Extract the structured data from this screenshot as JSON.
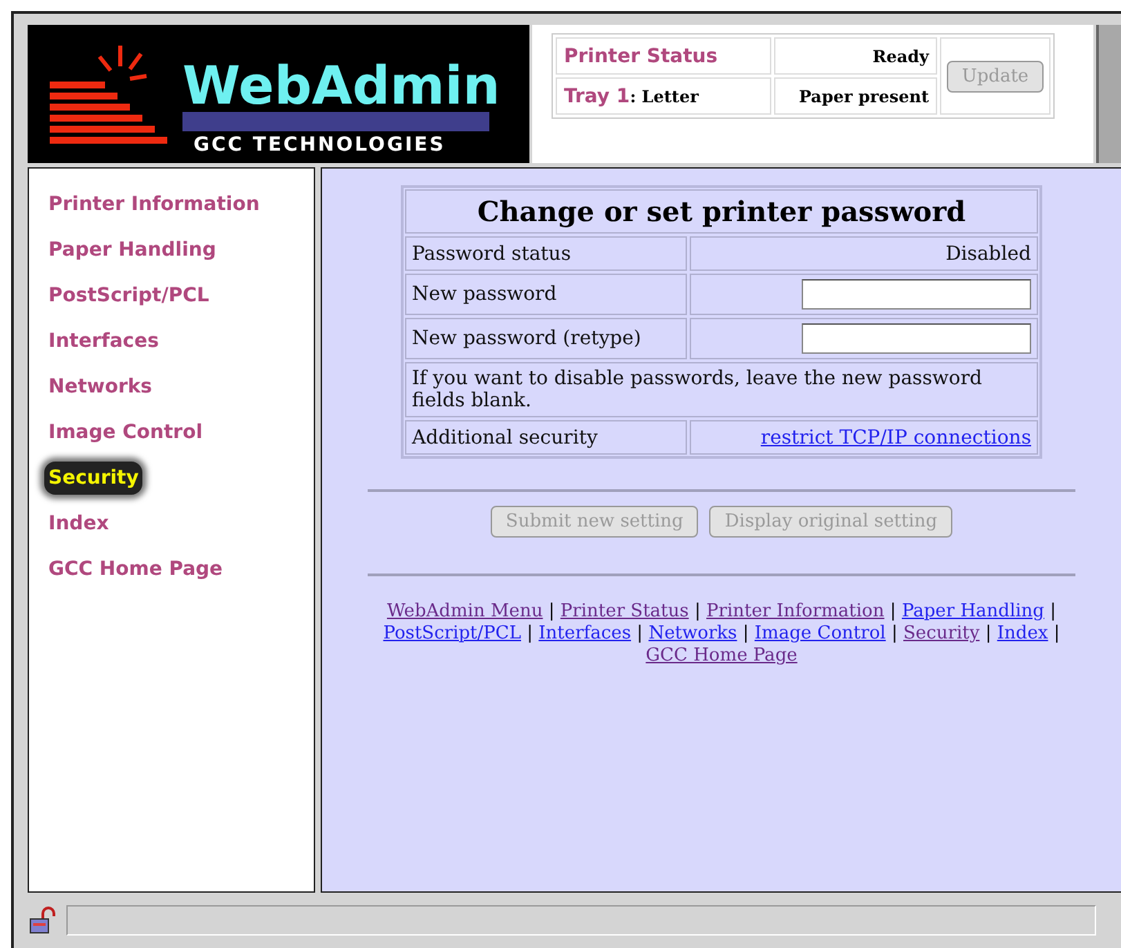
{
  "logo": {
    "title": "WebAdmin",
    "subtitle": "GCC TECHNOLOGIES"
  },
  "status": {
    "printer_label": "Printer Status",
    "printer_value": "Ready",
    "tray_label": "Tray 1",
    "tray_value": ": Letter",
    "paper_value": "Paper present",
    "update_button": {
      "label": "Update",
      "disabled": true
    }
  },
  "sidebar": {
    "items": [
      {
        "label": "Printer Information",
        "selected": false
      },
      {
        "label": "Paper Handling",
        "selected": false
      },
      {
        "label": "PostScript/PCL",
        "selected": false
      },
      {
        "label": "Interfaces",
        "selected": false
      },
      {
        "label": "Networks",
        "selected": false
      },
      {
        "label": "Image Control",
        "selected": false
      },
      {
        "label": "Security",
        "selected": true
      },
      {
        "label": "Index",
        "selected": false
      },
      {
        "label": "GCC Home Page",
        "selected": false
      }
    ]
  },
  "form": {
    "title": "Change or set printer password",
    "rows": [
      {
        "kind": "value",
        "label": "Password status",
        "value": "Disabled"
      },
      {
        "kind": "input",
        "label": "New password"
      },
      {
        "kind": "input",
        "label": "New password (retype)"
      },
      {
        "kind": "note",
        "text": "If you want to disable passwords, leave the new password fields blank."
      },
      {
        "kind": "link",
        "label": "Additional security",
        "value": "restrict TCP/IP connections"
      }
    ],
    "buttons": [
      {
        "label": "Submit new setting",
        "disabled": true
      },
      {
        "label": "Display original setting",
        "disabled": true
      }
    ]
  },
  "footer": {
    "separator": "|",
    "links": [
      {
        "label": "WebAdmin Menu",
        "visited": true
      },
      {
        "label": "Printer Status",
        "visited": true
      },
      {
        "label": "Printer Information",
        "visited": true
      },
      {
        "label": "Paper Handling",
        "visited": false
      },
      {
        "label": "PostScript/PCL",
        "visited": false
      },
      {
        "label": "Interfaces",
        "visited": false
      },
      {
        "label": "Networks",
        "visited": false
      },
      {
        "label": "Image Control",
        "visited": false
      },
      {
        "label": "Security",
        "visited": true
      },
      {
        "label": "Index",
        "visited": false
      },
      {
        "label": "GCC Home Page",
        "visited": true
      }
    ]
  }
}
